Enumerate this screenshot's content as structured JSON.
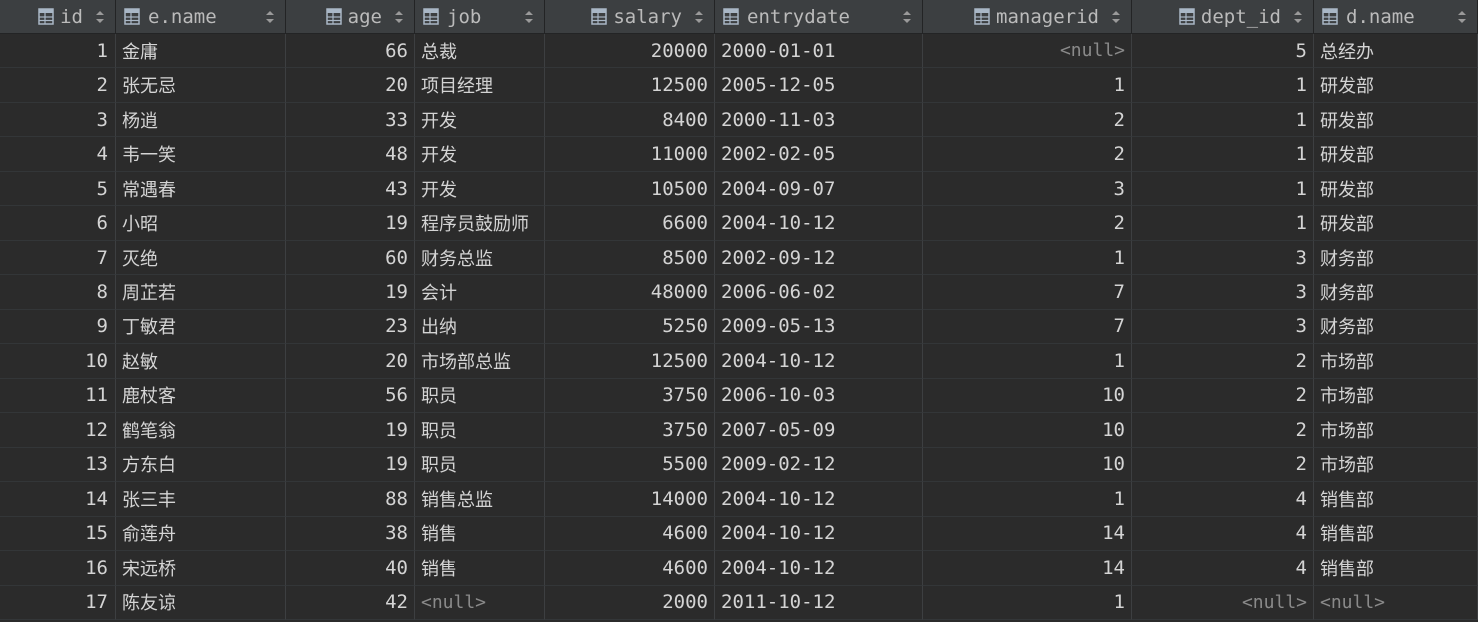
{
  "colors": {
    "background": "#2b2b2b",
    "header_background": "#3c3f41",
    "text": "#d4d4d4",
    "null_text": "#8a8a8a",
    "header_text": "#bbbbbb"
  },
  "table": {
    "columns": [
      {
        "key": "id",
        "label": "id",
        "align": "right"
      },
      {
        "key": "e_name",
        "label": "e.name",
        "align": "left"
      },
      {
        "key": "age",
        "label": "age",
        "align": "right"
      },
      {
        "key": "job",
        "label": "job",
        "align": "left"
      },
      {
        "key": "salary",
        "label": "salary",
        "align": "right"
      },
      {
        "key": "entrydate",
        "label": "entrydate",
        "align": "left"
      },
      {
        "key": "managerid",
        "label": "managerid",
        "align": "right"
      },
      {
        "key": "dept_id",
        "label": "dept_id",
        "align": "right"
      },
      {
        "key": "d_name",
        "label": "d.name",
        "align": "left"
      }
    ],
    "rows": [
      [
        "1",
        "金庸",
        "66",
        "总裁",
        "20000",
        "2000-01-01",
        "<null>",
        "5",
        "总经办"
      ],
      [
        "2",
        "张无忌",
        "20",
        "项目经理",
        "12500",
        "2005-12-05",
        "1",
        "1",
        "研发部"
      ],
      [
        "3",
        "杨逍",
        "33",
        "开发",
        "8400",
        "2000-11-03",
        "2",
        "1",
        "研发部"
      ],
      [
        "4",
        "韦一笑",
        "48",
        "开发",
        "11000",
        "2002-02-05",
        "2",
        "1",
        "研发部"
      ],
      [
        "5",
        "常遇春",
        "43",
        "开发",
        "10500",
        "2004-09-07",
        "3",
        "1",
        "研发部"
      ],
      [
        "6",
        "小昭",
        "19",
        "程序员鼓励师",
        "6600",
        "2004-10-12",
        "2",
        "1",
        "研发部"
      ],
      [
        "7",
        "灭绝",
        "60",
        "财务总监",
        "8500",
        "2002-09-12",
        "1",
        "3",
        "财务部"
      ],
      [
        "8",
        "周芷若",
        "19",
        "会计",
        "48000",
        "2006-06-02",
        "7",
        "3",
        "财务部"
      ],
      [
        "9",
        "丁敏君",
        "23",
        "出纳",
        "5250",
        "2009-05-13",
        "7",
        "3",
        "财务部"
      ],
      [
        "10",
        "赵敏",
        "20",
        "市场部总监",
        "12500",
        "2004-10-12",
        "1",
        "2",
        "市场部"
      ],
      [
        "11",
        "鹿杖客",
        "56",
        "职员",
        "3750",
        "2006-10-03",
        "10",
        "2",
        "市场部"
      ],
      [
        "12",
        "鹤笔翁",
        "19",
        "职员",
        "3750",
        "2007-05-09",
        "10",
        "2",
        "市场部"
      ],
      [
        "13",
        "方东白",
        "19",
        "职员",
        "5500",
        "2009-02-12",
        "10",
        "2",
        "市场部"
      ],
      [
        "14",
        "张三丰",
        "88",
        "销售总监",
        "14000",
        "2004-10-12",
        "1",
        "4",
        "销售部"
      ],
      [
        "15",
        "俞莲舟",
        "38",
        "销售",
        "4600",
        "2004-10-12",
        "14",
        "4",
        "销售部"
      ],
      [
        "16",
        "宋远桥",
        "40",
        "销售",
        "4600",
        "2004-10-12",
        "14",
        "4",
        "销售部"
      ],
      [
        "17",
        "陈友谅",
        "42",
        "<null>",
        "2000",
        "2011-10-12",
        "1",
        "<null>",
        "<null>"
      ]
    ]
  }
}
